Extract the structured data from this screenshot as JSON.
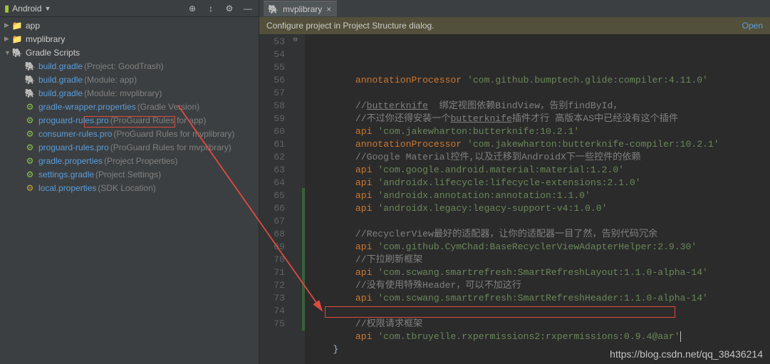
{
  "sidebar": {
    "view_label": "Android",
    "items": [
      {
        "icon": "folder",
        "label": "app",
        "indent": 0,
        "exp": "▶",
        "lbl_color": "#cccccc"
      },
      {
        "icon": "folder",
        "label": "mvplibrary",
        "indent": 0,
        "exp": "▶",
        "lbl_color": "#cccccc"
      },
      {
        "icon": "elephant",
        "label": "Gradle Scripts",
        "indent": 0,
        "exp": "▼",
        "lbl_color": "#cccccc"
      },
      {
        "icon": "elephant",
        "label": "build.gradle",
        "suffix": "(Project: GoodTrash)",
        "indent": 1
      },
      {
        "icon": "elephant",
        "label": "build.gradle",
        "suffix": "(Module: app)",
        "indent": 1
      },
      {
        "icon": "elephant",
        "label": "build.gradle",
        "suffix": "(Module: mvplibrary)",
        "indent": 1
      },
      {
        "icon": "gear",
        "label": "gradle-wrapper.properties",
        "suffix": "(Gradle Version)",
        "indent": 1
      },
      {
        "icon": "gear",
        "label": "proguard-rules.pro",
        "suffix": "(ProGuard Rules for app)",
        "indent": 1
      },
      {
        "icon": "gear",
        "label": "consumer-rules.pro",
        "suffix": "(ProGuard Rules for mvplibrary)",
        "indent": 1
      },
      {
        "icon": "gear",
        "label": "proguard-rules.pro",
        "suffix": "(ProGuard Rules for mvplibrary)",
        "indent": 1
      },
      {
        "icon": "gear",
        "label": "gradle.properties",
        "suffix": "(Project Properties)",
        "indent": 1
      },
      {
        "icon": "gear",
        "label": "settings.gradle",
        "suffix": "(Project Settings)",
        "indent": 1
      },
      {
        "icon": "gear-y",
        "label": "local.properties",
        "suffix": "(SDK Location)",
        "indent": 1
      }
    ]
  },
  "tab": {
    "icon": "elephant",
    "label": "mvplibrary"
  },
  "banner": {
    "message": "Configure project in Project Structure dialog.",
    "action": "Open"
  },
  "code": {
    "first_line": 53,
    "lines": [
      {
        "indent": 2,
        "kind": "stmt",
        "kw": "annotationProcessor",
        "str": "'com.github.bumptech.glide:compiler:4.11.0'"
      },
      {
        "indent": 2,
        "kind": "blank"
      },
      {
        "indent": 2,
        "kind": "cm",
        "text": "//butterknife  绑定视图依赖BindView，告别findById，",
        "und": "butterknife"
      },
      {
        "indent": 2,
        "kind": "cm",
        "text": "//不过你还得安装一个butterknife插件才行 高版本AS中已经没有这个插件",
        "und": "butterknife"
      },
      {
        "indent": 2,
        "kind": "stmt",
        "kw": "api",
        "str": "'com.jakewharton:butterknife:10.2.1'"
      },
      {
        "indent": 2,
        "kind": "stmt",
        "kw": "annotationProcessor",
        "str": "'com.jakewharton:butterknife-compiler:10.2.1'"
      },
      {
        "indent": 2,
        "kind": "cm",
        "text": "//Google Material控件,以及迁移到AndroidX下一些控件的依赖"
      },
      {
        "indent": 2,
        "kind": "stmt",
        "kw": "api",
        "str": "'com.google.android.material:material:1.2.0'"
      },
      {
        "indent": 2,
        "kind": "stmt",
        "kw": "api",
        "str": "'androidx.lifecycle:lifecycle-extensions:2.1.0'"
      },
      {
        "indent": 2,
        "kind": "stmt",
        "kw": "api",
        "str": "'androidx.annotation:annotation:1.1.0'"
      },
      {
        "indent": 2,
        "kind": "stmt",
        "kw": "api",
        "str": "'androidx.legacy:legacy-support-v4:1.0.0'"
      },
      {
        "indent": 2,
        "kind": "blank"
      },
      {
        "indent": 2,
        "kind": "cm",
        "text": "//RecyclerView最好的适配器，让你的适配器一目了然，告别代码冗余"
      },
      {
        "indent": 2,
        "kind": "stmt",
        "kw": "api",
        "str": "'com.github.CymChad:BaseRecyclerViewAdapterHelper:2.9.30'"
      },
      {
        "indent": 2,
        "kind": "cm",
        "text": "//下拉刷新框架"
      },
      {
        "indent": 2,
        "kind": "stmt",
        "kw": "api",
        "str": "'com.scwang.smartrefresh:SmartRefreshLayout:1.1.0-alpha-14'"
      },
      {
        "indent": 2,
        "kind": "cm",
        "text": "//没有使用特殊Header，可以不加这行"
      },
      {
        "indent": 2,
        "kind": "stmt",
        "kw": "api",
        "str": "'com.scwang.smartrefresh:SmartRefreshHeader:1.1.0-alpha-14'"
      },
      {
        "indent": 2,
        "kind": "blank"
      },
      {
        "indent": 2,
        "kind": "cm",
        "text": "//权限请求框架"
      },
      {
        "indent": 2,
        "kind": "stmt",
        "kw": "api",
        "str": "'com.tbruyelle.rxpermissions2:rxpermissions:0.9.4@aar'",
        "caret": true
      },
      {
        "indent": 1,
        "kind": "brace",
        "text": "}"
      },
      {
        "indent": 0,
        "kind": "blank"
      }
    ]
  },
  "watermark": "https://blog.csdn.net/qq_38436214"
}
